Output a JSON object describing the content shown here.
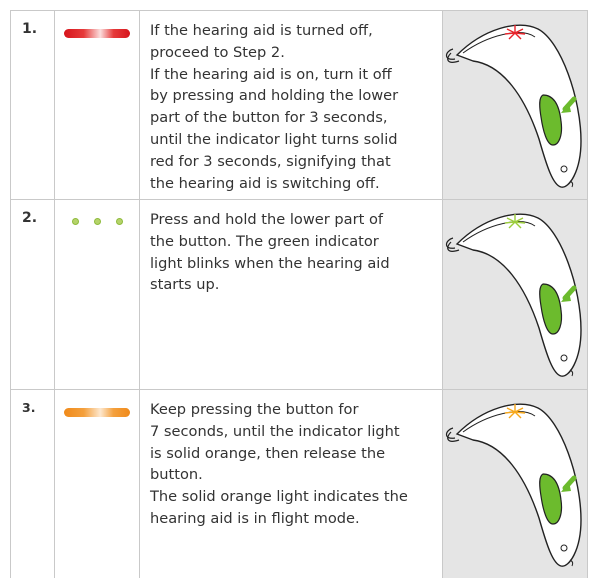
{
  "steps": [
    {
      "number": "1.",
      "indicator": "red-bar",
      "indicator_color": "#d7141c",
      "text": "If the hearing aid is turned off,\nproceed to Step 2.\nIf the hearing aid is on, turn it off\nby pressing and holding the lower\npart of the button for 3 seconds,\nuntil the indicator light turns solid\nred for 3 seconds, signifying that\nthe hearing aid is switching off.",
      "light_color": "#e8232a"
    },
    {
      "number": "2.",
      "indicator": "green-blinking-dots",
      "indicator_color": "#b5d36a",
      "text": "Press and hold the lower part of\nthe button. The green indicator\nlight blinks when the hearing aid\nstarts up.",
      "light_color": "#9ccd3c"
    },
    {
      "number": "3.",
      "indicator": "orange-bar",
      "indicator_color": "#f08a1a",
      "text": "Keep pressing the button  for\n7 seconds, until the indicator light\nis solid orange, then release the\nbutton.\nThe solid orange light indicates the\nhearing aid is in flight mode.",
      "light_color": "#f7a81b"
    }
  ],
  "button_color": "#6cbb2d"
}
